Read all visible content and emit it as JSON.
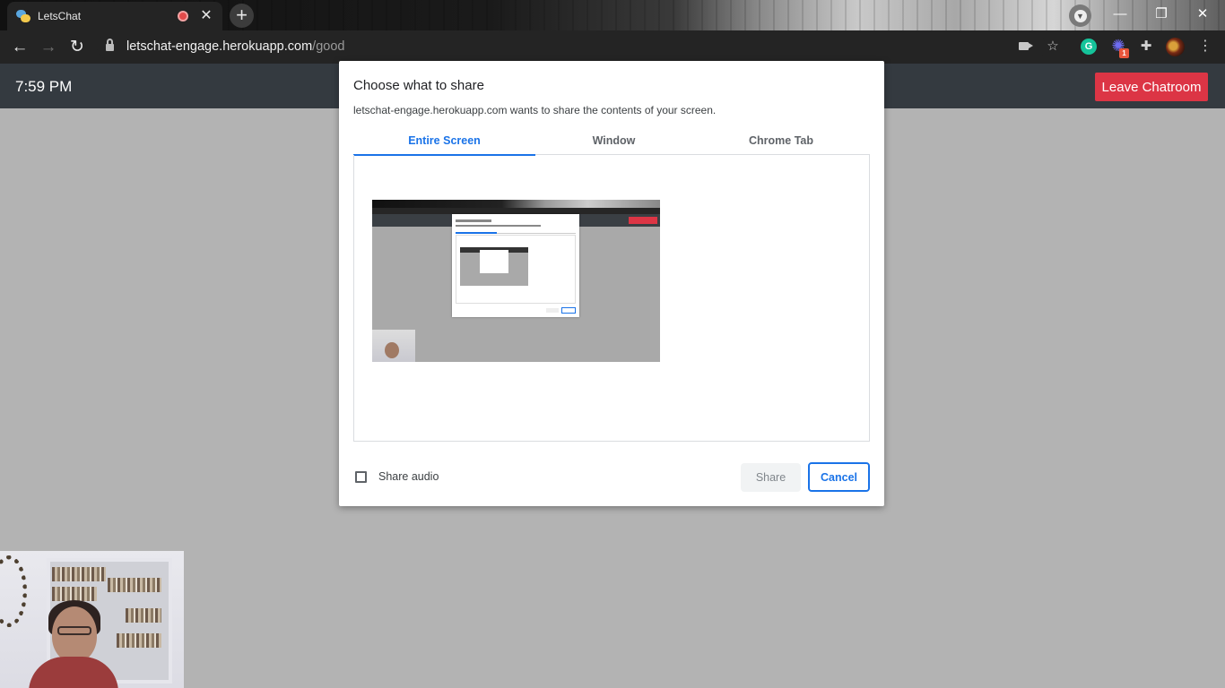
{
  "browser": {
    "tab_title": "LetsChat",
    "new_tab_icon": "+",
    "close_tab_icon": "✕",
    "url_host": "letschat-engage.herokuapp.com",
    "url_path": "/good",
    "extension_badge": "1",
    "grammarly_letter": "G"
  },
  "app": {
    "clock": "7:59 PM",
    "leave_button": "Leave Chatroom",
    "colors": {
      "appbar": "#343a40",
      "leave": "#dc3545",
      "page_bg": "#b3b3b3"
    }
  },
  "share_dialog": {
    "title": "Choose what to share",
    "subtitle": "letschat-engage.herokuapp.com wants to share the contents of your screen.",
    "tabs": [
      {
        "label": "Entire Screen",
        "active": true
      },
      {
        "label": "Window",
        "active": false
      },
      {
        "label": "Chrome Tab",
        "active": false
      }
    ],
    "share_audio_label": "Share audio",
    "share_audio_checked": false,
    "share_button": "Share",
    "cancel_button": "Cancel",
    "accent": "#1a73e8"
  }
}
